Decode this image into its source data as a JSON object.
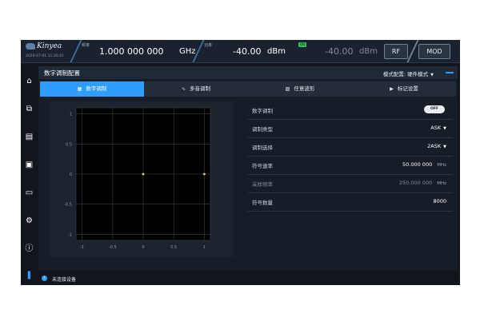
{
  "topbar": {
    "brand": "Kinyea",
    "datetime": "2020-07-01 11:26:41",
    "freq_label": "频率",
    "freq_value": "1.000 000 000",
    "freq_unit": "GHz",
    "power_label": "功率",
    "power_value": "-40.00",
    "power_unit": "dBm",
    "power_badge": "ON",
    "power_value2": "-40.00",
    "power_unit2": "dBm",
    "rf_label": "RF",
    "mod_label": "MOD"
  },
  "sidebar": {
    "items": [
      {
        "icon": "home-icon",
        "glyph": "⌂"
      },
      {
        "icon": "windows-icon",
        "glyph": "⧉"
      },
      {
        "icon": "scpi-icon",
        "glyph": "▤"
      },
      {
        "icon": "waveform-icon",
        "glyph": "▣"
      },
      {
        "icon": "screen-icon",
        "glyph": "▭"
      },
      {
        "icon": "gear-icon",
        "glyph": "⚙"
      },
      {
        "icon": "info-icon",
        "glyph": "ⓘ"
      },
      {
        "icon": "app-logo-icon",
        "glyph": "❚"
      }
    ]
  },
  "panel": {
    "title": "数字调制配置",
    "mode_label": "模式配置:",
    "mode_value": "硬件模式"
  },
  "tabs": [
    {
      "label": "数字调制",
      "icon": "digital-mod-icon",
      "glyph": "▦",
      "active": true
    },
    {
      "label": "多音调制",
      "icon": "multitone-icon",
      "glyph": "∿",
      "active": false
    },
    {
      "label": "任意波形",
      "icon": "arbitrary-wave-icon",
      "glyph": "▨",
      "active": false
    },
    {
      "label": "标记设置",
      "icon": "marker-icon",
      "glyph": "▶",
      "active": false
    }
  ],
  "chart_data": {
    "type": "scatter",
    "title": "",
    "xlabel": "",
    "ylabel": "",
    "xlim": [
      -1.1,
      1.1
    ],
    "ylim": [
      -1.1,
      1.1
    ],
    "x_ticks": [
      -1,
      -0.5,
      0,
      0.5,
      1
    ],
    "y_ticks": [
      1,
      0.5,
      0,
      -0.5,
      -1
    ],
    "x_tick_labels": [
      "-1",
      "-0.5",
      "0",
      "0.5",
      "1"
    ],
    "y_tick_labels": [
      "1",
      "0.5",
      "0",
      "-0.5",
      "-1"
    ],
    "grid": true,
    "point_color": "#e8e04a",
    "points": [
      {
        "x": 0,
        "y": 0
      },
      {
        "x": 1,
        "y": 0
      }
    ]
  },
  "params": [
    {
      "label": "数字调制",
      "type": "toggle",
      "value": "OFF"
    },
    {
      "label": "调制类型",
      "type": "select",
      "value": "ASK"
    },
    {
      "label": "调制选择",
      "type": "select",
      "value": "2ASK"
    },
    {
      "label": "符号速率",
      "type": "number",
      "value": "50.000 000",
      "unit": "MHz"
    },
    {
      "label": "采样频率",
      "type": "number",
      "value": "250.000 000",
      "unit": "MHz",
      "disabled": true
    },
    {
      "label": "符号数量",
      "type": "number",
      "value": "8000"
    }
  ],
  "status": {
    "text": "未连接设备"
  },
  "colors": {
    "accent": "#2e9dff",
    "background": "#12161c",
    "point": "#e8e04a"
  }
}
